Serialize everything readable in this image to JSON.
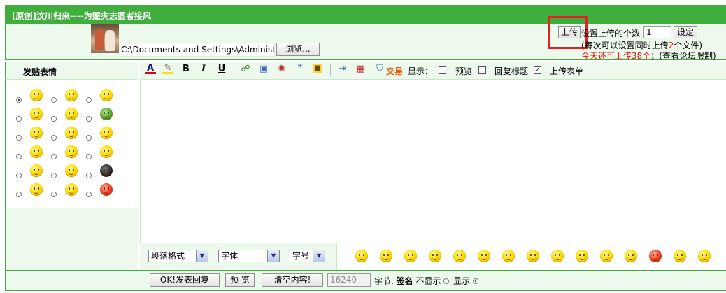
{
  "header": {
    "title": "[原创]汶川归来----为赈灾志愿者接风"
  },
  "upload": {
    "file_path": "C:\\Documents and Settings\\Administrator",
    "browse_label": "浏览...",
    "upload_label": "上传",
    "count_label": "设置上传的个数",
    "count_value": "1",
    "set_label": "设定",
    "hint_prefix": "(每次可以设置同时上传",
    "hint_num": "2",
    "hint_suffix": "个文件)",
    "remaining_text": "今天还可上传38个",
    "remaining_suffix": "；(查看论坛限制)"
  },
  "emotion_panel": {
    "title": "发贴表情",
    "icons": [
      "smile-icon",
      "shy-icon",
      "grin-icon",
      "love-eyes-icon",
      "tongue-icon",
      "turtle-icon",
      "angry-icon",
      "wink-icon",
      "surprised-icon",
      "confused-icon",
      "worried-icon",
      "cry-icon",
      "yawn-icon",
      "smirk-icon",
      "penguin-icon",
      "sad-icon",
      "hammer-icon",
      "furious-icon"
    ],
    "selected_index": 0
  },
  "toolbar": {
    "trade_label": "交易",
    "display_label": "显示：",
    "preview_label": "预览",
    "preview_checked": false,
    "reply_title_label": "回复标题",
    "reply_title_checked": false,
    "upload_form_label": "上传表单",
    "upload_form_checked": true
  },
  "format_bar": {
    "paragraph_label": "段落格式",
    "font_label": "字体",
    "size_label": "字号"
  },
  "smiley_bar": {
    "icons": [
      "smile-icon",
      "love-eyes-icon",
      "blush-icon",
      "shock-icon",
      "cool-icon",
      "angry-icon",
      "wink-icon",
      "think-icon",
      "laugh-icon",
      "scream-icon",
      "sad-icon",
      "shy-icon",
      "annoyed-icon",
      "grimace-icon",
      "dizzy-icon",
      "sleepy-icon"
    ]
  },
  "bottom": {
    "submit_label": "OK!发表回复",
    "preview_label": "预 览",
    "clear_label": "清空内容!",
    "byte_value": "16240",
    "byte_label": "字节.",
    "signature_label": "签名",
    "hide_label": "不显示",
    "show_label": "显示",
    "signature_selected": "show"
  }
}
